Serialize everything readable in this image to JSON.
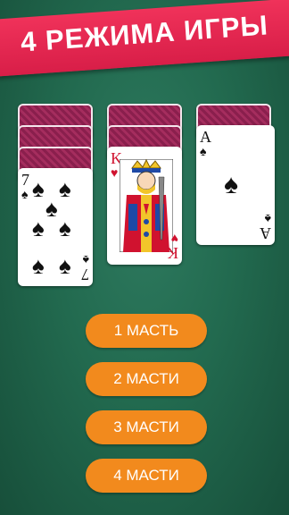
{
  "banner": {
    "title": "4 РЕЖИМА ИГРЫ"
  },
  "cards": {
    "seven": {
      "rank": "7",
      "suit": "♠"
    },
    "king": {
      "rank": "K",
      "suit": "♥"
    },
    "ace": {
      "rank": "A",
      "suit": "♠"
    }
  },
  "modes": [
    {
      "label": "1 МАСТЬ"
    },
    {
      "label": "2 МАСТИ"
    },
    {
      "label": "3 МАСТИ"
    },
    {
      "label": "4 МАСТИ"
    }
  ],
  "colors": {
    "banner": "#e8274f",
    "button": "#f28a1d",
    "table": "#226a4f",
    "card_back": "#8a1f4d"
  }
}
